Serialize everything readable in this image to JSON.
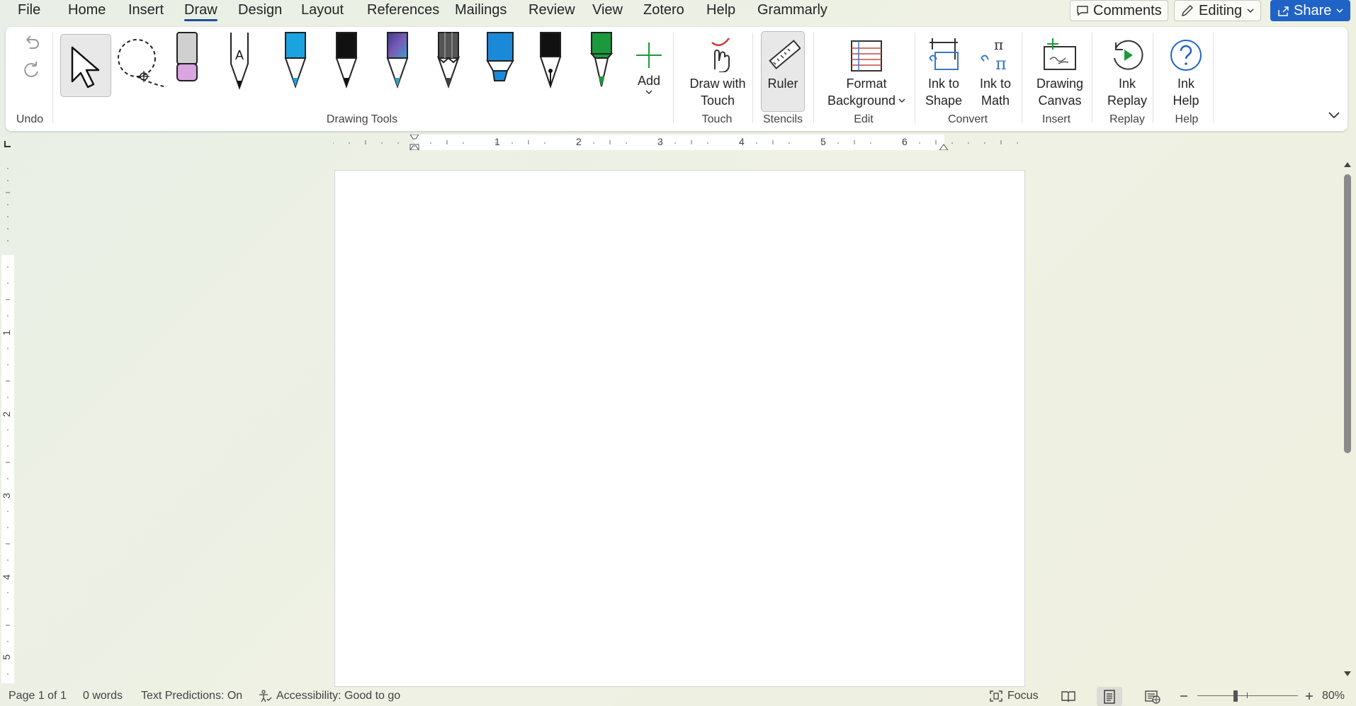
{
  "menu": {
    "items": [
      "File",
      "Home",
      "Insert",
      "Draw",
      "Design",
      "Layout",
      "References",
      "Mailings",
      "Review",
      "View",
      "Zotero",
      "Help",
      "Grammarly"
    ],
    "active": "Draw"
  },
  "top_buttons": {
    "comments": "Comments",
    "editing": "Editing",
    "share": "Share"
  },
  "ribbon": {
    "groups": {
      "undo": "Undo",
      "drawing_tools": "Drawing Tools",
      "touch": "Touch",
      "stencils": "Stencils",
      "edit": "Edit",
      "convert": "Convert",
      "insert": "Insert",
      "replay": "Replay",
      "help": "Help"
    },
    "buttons": {
      "add": "Add",
      "draw_with_touch_1": "Draw with",
      "draw_with_touch_2": "Touch",
      "ruler": "Ruler",
      "format_background_1": "Format",
      "format_background_2": "Background",
      "ink_to_shape_1": "Ink to",
      "ink_to_shape_2": "Shape",
      "ink_to_math_1": "Ink to",
      "ink_to_math_2": "Math",
      "drawing_canvas_1": "Drawing",
      "drawing_canvas_2": "Canvas",
      "ink_replay_1": "Ink",
      "ink_replay_2": "Replay",
      "ink_help_1": "Ink",
      "ink_help_2": "Help"
    },
    "pen_colors": {
      "highlighter_pink": "#d9a6e0",
      "pen_blue": "#1aa3e0",
      "pen_black": "#111111",
      "pen_galaxy": "#5a5aa8",
      "pencil_gray": "#555555",
      "highlighter_blue": "#1a8ad8",
      "fountain_black": "#111111",
      "pen_green": "#1a9a3c"
    }
  },
  "ruler": {
    "h_numbers": [
      "1",
      "2",
      "3",
      "4",
      "5",
      "6"
    ],
    "v_numbers": [
      "1",
      "2",
      "3",
      "4",
      "5"
    ]
  },
  "status": {
    "page": "Page 1 of 1",
    "words": "0 words",
    "predictions": "Text Predictions: On",
    "accessibility": "Accessibility: Good to go",
    "focus": "Focus",
    "zoom": "80%"
  },
  "zoom_level_percent": 80
}
